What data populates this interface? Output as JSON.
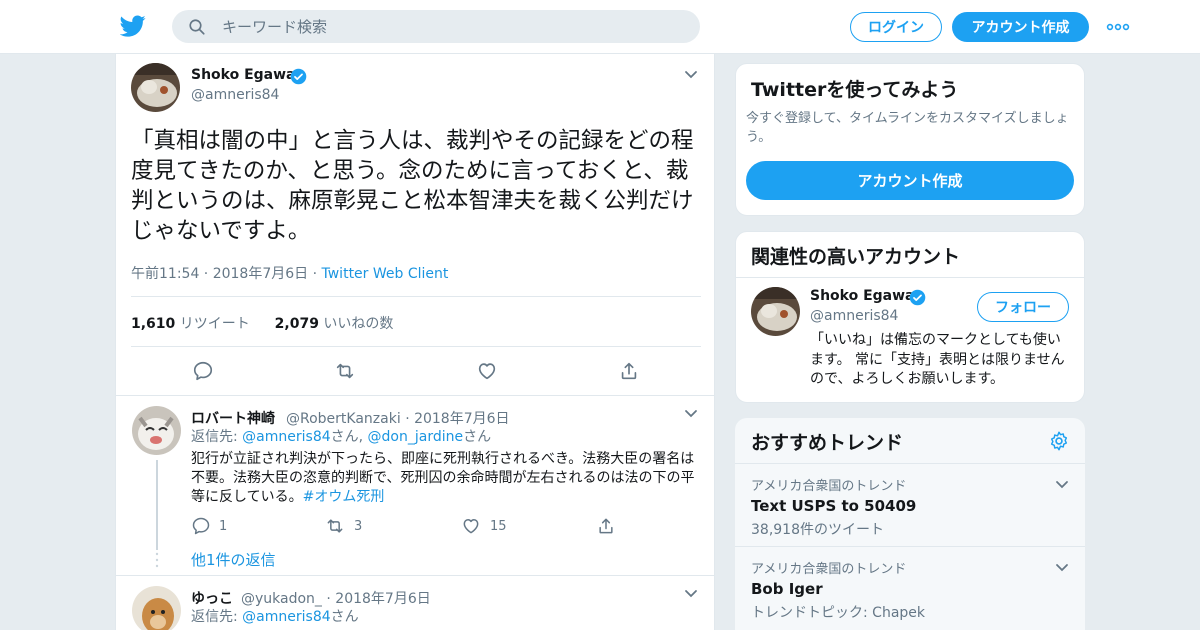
{
  "header": {
    "search_placeholder": "キーワード検索",
    "login_label": "ログイン",
    "signup_label": "アカウント作成"
  },
  "tweet": {
    "author_name": "Shoko Egawa",
    "author_handle": "@amneris84",
    "text": "「真相は闇の中」と言う人は、裁判やその記録をどの程度見てきたのか、と思う。念のために言っておくと、裁判というのは、麻原彰晃こと松本智津夫を裁く公判だけじゃないですよ。",
    "time": "午前11:54 · 2018年7月6日 · ",
    "client": "Twitter Web Client",
    "retweet_count": "1,610",
    "retweet_label": "リツイート",
    "like_count": "2,079",
    "like_label": "いいねの数"
  },
  "replies": [
    {
      "name": "ロバート神崎",
      "handle": "@RobertKanzaki",
      "date": "· 2018年7月6日",
      "reply_prefix": "返信先: ",
      "reply_to_1": "@amneris84",
      "reply_sep": "さん, ",
      "reply_to_2": "@don_jardine",
      "reply_suffix": "さん",
      "text": "犯行が立証され判決が下ったら、即座に死刑執行されるべき。法務大臣の署名は不要。法務大臣の恣意的判断で、死刑囚の余命時間が左右されるのは法の下の平等に反している。",
      "hashtag": "#オウム死刑",
      "reply_count": "1",
      "retweet_count": "3",
      "like_count": "15",
      "more_replies": "他1件の返信"
    },
    {
      "name": "ゆっこ",
      "handle": "@yukadon_",
      "date": "· 2018年7月6日",
      "reply_prefix": "返信先: ",
      "reply_to_1": "@amneris84",
      "reply_suffix": "さん"
    }
  ],
  "signup_card": {
    "title": "Twitterを使ってみよう",
    "subtitle": "今すぐ登録して、タイムラインをカスタマイズしましょう。",
    "button": "アカウント作成"
  },
  "related": {
    "title": "関連性の高いアカウント",
    "name": "Shoko Egawa",
    "handle": "@amneris84",
    "follow": "フォロー",
    "bio": "「いいね」は備忘のマークとしても使います。 常に「支持」表明とは限りませんので、よろしくお願いします。"
  },
  "trends": {
    "title": "おすすめトレンド",
    "items": [
      {
        "location": "アメリカ合衆国のトレンド",
        "name": "Text USPS to 50409",
        "meta": "38,918件のツイート"
      },
      {
        "location": "アメリカ合衆国のトレンド",
        "name": "Bob Iger",
        "meta": "トレンドトピック: Chapek"
      }
    ]
  },
  "colors": {
    "accent": "#1da1f2",
    "link": "#1b95e0",
    "muted": "#657786",
    "background": "#e6ecf0"
  },
  "icons": [
    "twitter-bird-icon",
    "search-icon",
    "more-dots-icon",
    "verified-badge-icon",
    "chevron-down-icon",
    "reply-icon",
    "retweet-icon",
    "like-icon",
    "share-icon",
    "gear-icon"
  ]
}
